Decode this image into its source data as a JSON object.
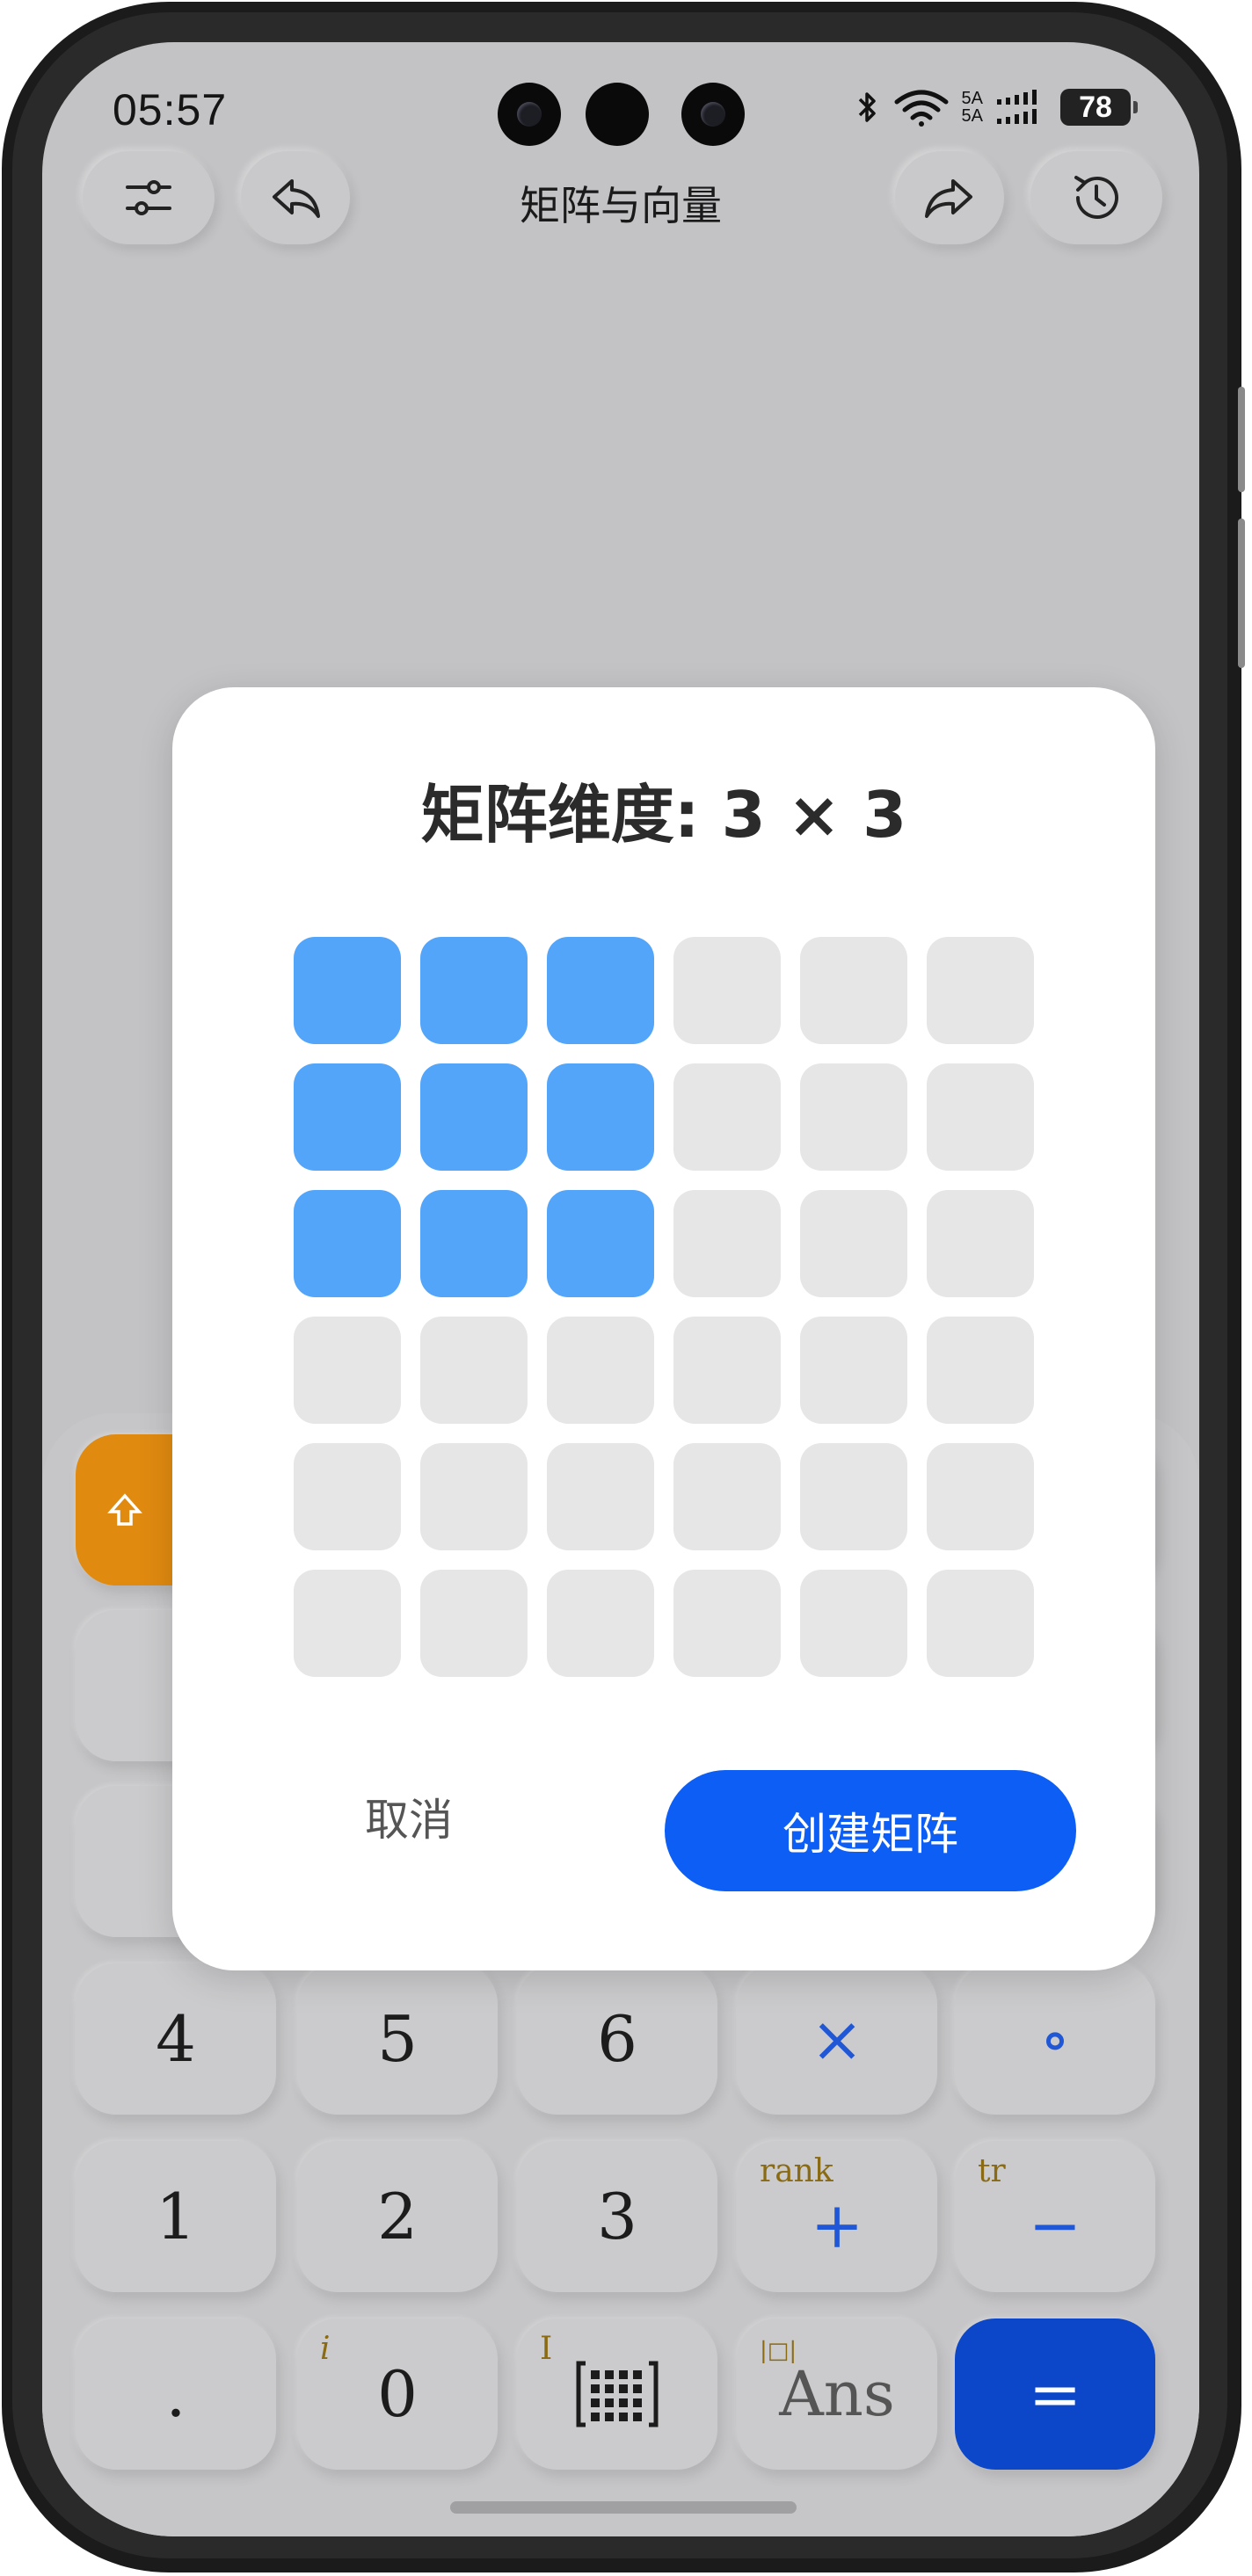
{
  "status_bar": {
    "time": "05:57",
    "signal_top": "5A",
    "signal_bottom": "5A",
    "battery": "78"
  },
  "header": {
    "title": "矩阵与向量",
    "settings_icon": "sliders-icon",
    "undo_icon": "undo-arrow-icon",
    "redo_icon": "redo-arrow-icon",
    "history_icon": "clock-history-icon"
  },
  "keypad": {
    "row1": [
      "4",
      "5",
      "6",
      "×",
      "∘"
    ],
    "row2": [
      {
        "label": "1",
        "sup": ""
      },
      {
        "label": "2",
        "sup": ""
      },
      {
        "label": "3",
        "sup": ""
      },
      {
        "label": "+",
        "sup": "rank"
      },
      {
        "label": "−",
        "sup": "tr"
      }
    ],
    "row3": [
      {
        "label": ".",
        "sup": ""
      },
      {
        "label": "0",
        "sup": "i"
      },
      {
        "label": "",
        "sup": "I"
      },
      {
        "label": "Ans",
        "sup": "|□|"
      },
      {
        "label": "=",
        "sup": ""
      }
    ],
    "matrix_icon": "matrix-grid-icon"
  },
  "dialog": {
    "title": "矩阵维度: 3 × 3",
    "rows_selected": 3,
    "cols_selected": 3,
    "grid_size": 6,
    "cancel_label": "取消",
    "create_label": "创建矩阵"
  },
  "colors": {
    "accent": "#0c5ef5",
    "cell_selected": "#53a5fa",
    "cell_empty": "#e6e6e6",
    "shift_key": "#e08a10",
    "danger_key": "#d9533a"
  }
}
